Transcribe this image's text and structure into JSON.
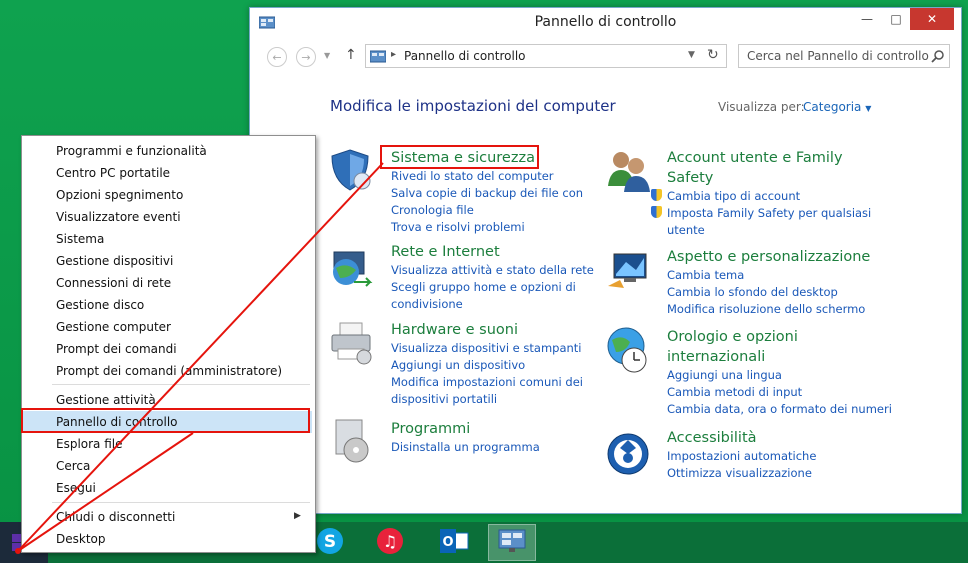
{
  "window": {
    "title": "Pannello di controllo",
    "address": "Pannello di controllo",
    "search_placeholder": "Cerca nel Pannello di controllo"
  },
  "main": {
    "heading": "Modifica le impostazioni del computer",
    "view_by_label": "Visualizza per:",
    "view_by_value": "Categoria"
  },
  "categories": {
    "sistema": {
      "title": "Sistema e sicurezza",
      "links": [
        "Rivedi lo stato del computer",
        "Salva copie di backup dei file con",
        "Cronologia file",
        "Trova e risolvi problemi"
      ]
    },
    "rete": {
      "title": "Rete e Internet",
      "links": [
        "Visualizza attività e stato della rete",
        "Scegli gruppo home e opzioni di",
        "condivisione"
      ]
    },
    "hardware": {
      "title": "Hardware e suoni",
      "links": [
        "Visualizza dispositivi e stampanti",
        "Aggiungi un dispositivo",
        "Modifica impostazioni comuni dei",
        "dispositivi portatili"
      ]
    },
    "programmi": {
      "title": "Programmi",
      "links": [
        "Disinstalla un programma"
      ]
    },
    "account": {
      "title_line1": "Account utente e Family",
      "title_line2": "Safety",
      "links": [
        "Cambia tipo di account",
        "Imposta Family Safety per qualsiasi",
        "utente"
      ]
    },
    "aspetto": {
      "title": "Aspetto e personalizzazione",
      "links": [
        "Cambia tema",
        "Cambia lo sfondo del desktop",
        "Modifica risoluzione dello schermo"
      ]
    },
    "orologio": {
      "title_line1": "Orologio e opzioni",
      "title_line2": "internazionali",
      "links": [
        "Aggiungi una lingua",
        "Cambia metodi di input",
        "Cambia data, ora o formato dei numeri"
      ]
    },
    "accessibilita": {
      "title": "Accessibilità",
      "links": [
        "Impostazioni automatiche",
        "Ottimizza visualizzazione"
      ]
    }
  },
  "menu": {
    "items": [
      "Programmi e funzionalità",
      "Centro PC portatile",
      "Opzioni spegnimento",
      "Visualizzatore eventi",
      "Sistema",
      "Gestione dispositivi",
      "Connessioni di rete",
      "Gestione disco",
      "Gestione computer",
      "Prompt dei comandi",
      "Prompt dei comandi (amministratore)",
      "Gestione attività",
      "Pannello di controllo",
      "Esplora file",
      "Cerca",
      "Esegui",
      "Chiudi o disconnetti",
      "Desktop"
    ],
    "highlighted": "Pannello di controllo"
  },
  "colors": {
    "desktop": "#0a9a49",
    "highlight": "#e5140d",
    "link": "#1a58b8",
    "category": "#1c7e3d"
  },
  "taskbar": {
    "icons": [
      "start-icon",
      "skype-icon",
      "itunes-icon",
      "outlook-icon",
      "control-panel-icon"
    ]
  }
}
